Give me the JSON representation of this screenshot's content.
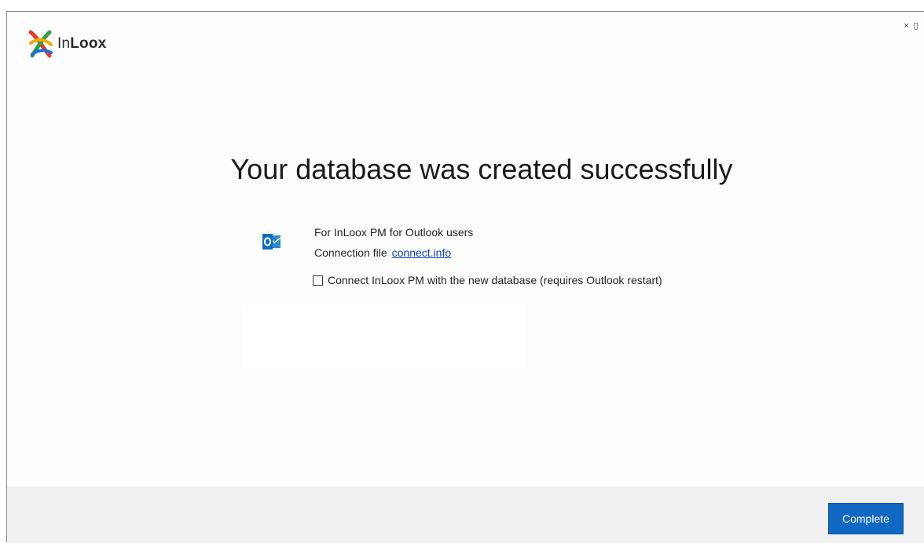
{
  "app": {
    "logo_text_regular": "In",
    "logo_text_bold": "Loox"
  },
  "window_controls": {
    "close_label": "×",
    "restore_label": "▯"
  },
  "main": {
    "headline": "Your database was created successfully",
    "outlook_users_label": "For InLoox PM for Outlook users",
    "connection_file_label": "Connection file",
    "connection_file_link": "connect.info",
    "connect_checkbox_label": "Connect InLoox PM with the new database (requires Outlook restart)",
    "connect_checkbox_checked": false
  },
  "footer": {
    "complete_label": "Complete"
  },
  "colors": {
    "accent": "#1068c2",
    "link": "#0b3fd4",
    "footer_bg": "#f0f0f0",
    "outlook_blue": "#0f6cbd"
  },
  "icons": {
    "logo": "inloox-logo-icon",
    "outlook": "outlook-icon"
  }
}
